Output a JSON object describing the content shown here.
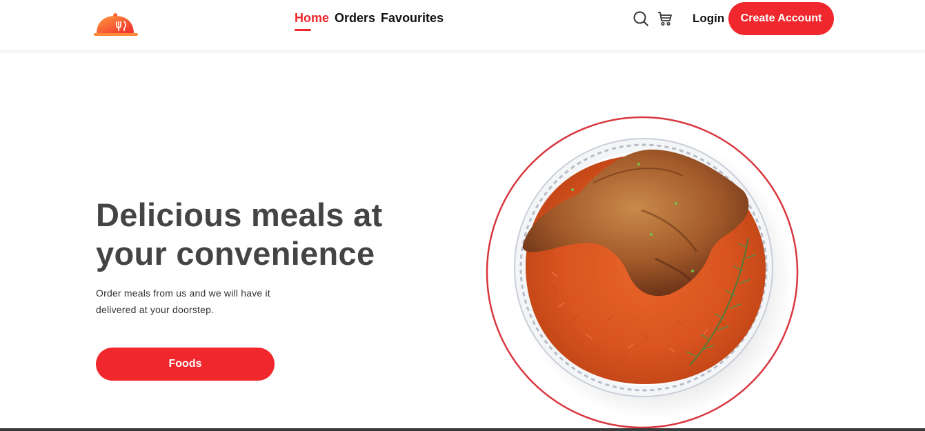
{
  "brand": {
    "logo_icon": "cloche-fork-knife-icon",
    "colors": {
      "accent": "#f0282d",
      "logo_orange": "#ff7a2e",
      "text_dark": "#444444",
      "ring": "#d9363e"
    }
  },
  "nav": {
    "links": [
      {
        "label": "Home",
        "active": true
      },
      {
        "label": "Orders",
        "active": false
      },
      {
        "label": "Favourites",
        "active": false
      }
    ],
    "icons": [
      "search-icon",
      "cart-icon"
    ],
    "login_label": "Login",
    "create_account_label": "Create Account"
  },
  "hero": {
    "title": "Delicious meals at your convenience",
    "subtitle": "Order meals from us and we will have it delivered at your doorstep.",
    "cta_label": "Foods",
    "image": "jollof-rice-with-chicken"
  }
}
